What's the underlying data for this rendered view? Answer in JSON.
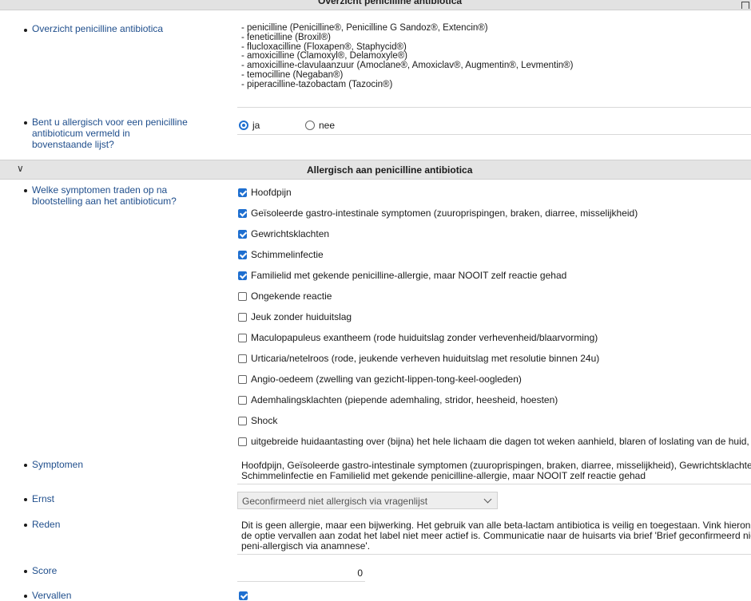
{
  "top_header": {
    "title": "Overzicht penicilline antibiotica"
  },
  "overview": {
    "label": "Overzicht penicilline antibiotica",
    "items": [
      "- penicilline (Penicilline®, Penicilline G Sandoz®, Extencin®)",
      "- feneticilline (Broxil®)",
      "- flucloxacilline (Floxapen®, Staphycid®)",
      "- amoxicilline (Clamoxyl®, Delamoxyle®)",
      "- amoxicilline-clavulaanzuur (Amoclane®, Amoxiclav®, Augmentin®, Levmentin®)",
      "- temocilline (Negaban®)",
      "- piperacilline-tazobactam (Tazocin®)"
    ]
  },
  "allergy_question": {
    "label_lines": [
      "Bent u allergisch voor een penicilline",
      "antibioticum vermeld in",
      "bovenstaande lijst?"
    ],
    "options": [
      {
        "label": "ja",
        "selected": true
      },
      {
        "label": "nee",
        "selected": false
      }
    ]
  },
  "section": {
    "title": "Allergisch aan penicilline antibiotica",
    "expanded": true
  },
  "symptoms_question": {
    "label_lines": [
      "Welke symptomen traden op na",
      "blootstelling aan het antibioticum?"
    ],
    "options": [
      {
        "label": "Hoofdpijn",
        "checked": true
      },
      {
        "label": "Geïsoleerde gastro-intestinale symptomen (zuuroprispingen, braken, diarree, misselijkheid)",
        "checked": true
      },
      {
        "label": "Gewrichtsklachten",
        "checked": true
      },
      {
        "label": "Schimmelinfectie",
        "checked": true
      },
      {
        "label": "Familielid met gekende penicilline-allergie, maar NOOIT zelf reactie gehad",
        "checked": true
      },
      {
        "label": "Ongekende reactie",
        "checked": false
      },
      {
        "label": "Jeuk zonder huiduitslag",
        "checked": false
      },
      {
        "label": "Maculopapuleus exantheem (rode huiduitslag zonder verhevenheid/blaarvorming)",
        "checked": false
      },
      {
        "label": "Urticaria/netelroos (rode, jeukende verheven huiduitslag met resolutie binnen 24u)",
        "checked": false
      },
      {
        "label": "Angio-oedeem (zwelling van gezicht-lippen-tong-keel-oogleden)",
        "checked": false
      },
      {
        "label": "Ademhalingsklachten (piepende ademhaling, stridor, heesheid, hoesten)",
        "checked": false
      },
      {
        "label": "Shock",
        "checked": false
      },
      {
        "label": "uitgebreide huidaantasting over (bijna) het hele lichaam die dagen tot weken aanhield, blaren of loslating van de huid,",
        "checked": false
      }
    ]
  },
  "symptomen": {
    "label": "Symptomen",
    "lines": [
      "Hoofdpijn, Geïsoleerde gastro-intestinale symptomen (zuuroprispingen, braken, diarree, misselijkheid), Gewrichtsklachten",
      "Schimmelinfectie en Familielid met gekende penicilline-allergie, maar NOOIT zelf reactie gehad"
    ]
  },
  "ernst": {
    "label": "Ernst",
    "value": "Geconfirmeerd niet allergisch via vragenlijst"
  },
  "reden": {
    "label": "Reden",
    "lines": [
      "Dit is geen allergie, maar een bijwerking. Het gebruik van alle beta-lactam antibiotica is veilig en toegestaan. Vink hierond",
      "de optie vervallen aan zodat het label niet meer actief is. Communicatie naar de huisarts via brief 'Brief geconfirmeerd nie",
      "peni-allergisch via anamnese'."
    ]
  },
  "score": {
    "label": "Score",
    "value": "0"
  },
  "vervallen": {
    "label": "Vervallen",
    "checked": true
  },
  "colors": {
    "accent": "#1e6fd0",
    "label_blue": "#1f4e8c",
    "section_bg": "#e4e4e4"
  }
}
